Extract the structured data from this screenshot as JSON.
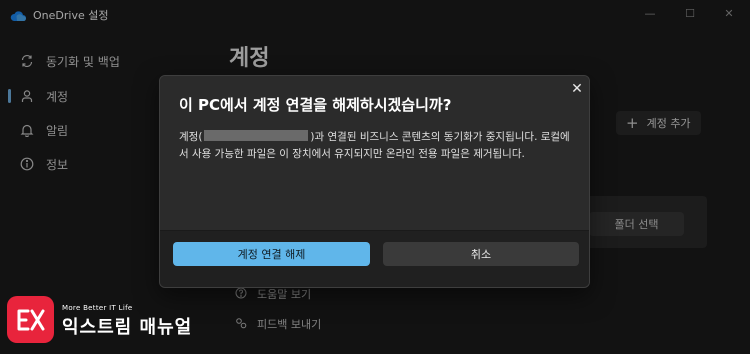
{
  "window": {
    "title": "OneDrive 설정",
    "minimize_glyph": "—",
    "maximize_glyph": "☐",
    "close_glyph": "✕"
  },
  "sidebar": {
    "items": [
      {
        "label": "동기화 및 백업",
        "icon": "sync-icon"
      },
      {
        "label": "계정",
        "icon": "person-icon",
        "selected": true
      },
      {
        "label": "알림",
        "icon": "bell-icon"
      },
      {
        "label": "정보",
        "icon": "info-icon"
      }
    ]
  },
  "main": {
    "title": "계정",
    "add_account_label": "계정 추가",
    "folder_select_label": "폴더 선택",
    "help_link": "도움말 보기",
    "feedback_link": "피드백 보내기"
  },
  "dialog": {
    "title": "이 PC에서 계정 연결을 해제하시겠습니까?",
    "message_prefix": "계정(",
    "message_suffix": ")과 연결된 비즈니스 콘텐츠의 동기화가 중지됩니다. 로컬에서 사용 가능한 파일은 이 장치에서 유지되지만 온라인 전용 파일은 제거됩니다.",
    "primary_button": "계정 연결 해제",
    "secondary_button": "취소",
    "close_glyph": "✕"
  },
  "watermark": {
    "tagline": "More Better IT Life",
    "name": "익스트림 매뉴얼"
  },
  "colors": {
    "accent": "#60b6ea",
    "background": "#1c1c1c",
    "dialog": "#2b2b2b",
    "watermark": "#e8243c"
  }
}
